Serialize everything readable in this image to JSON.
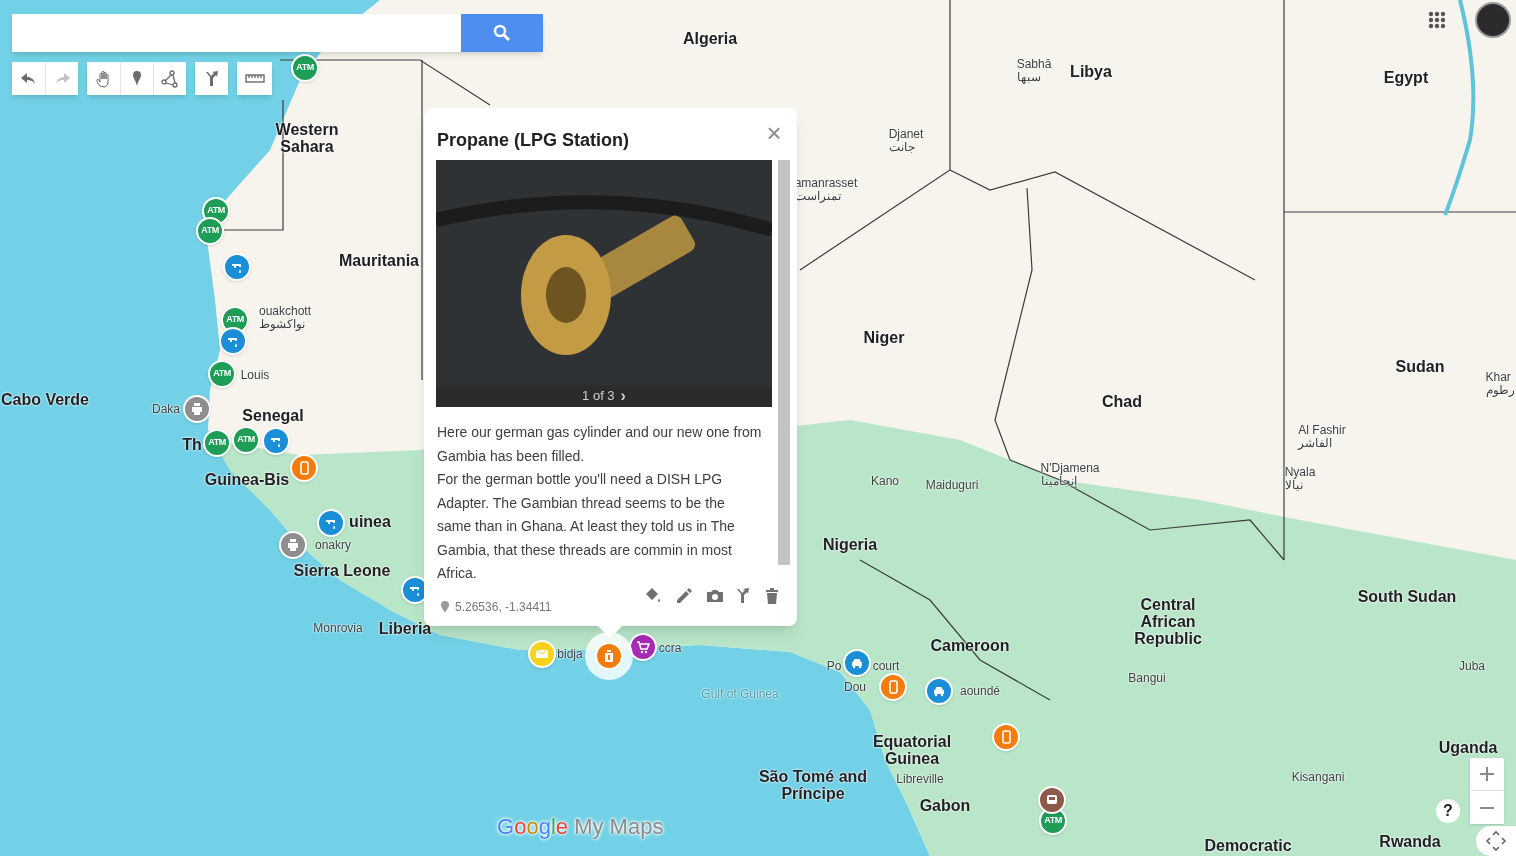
{
  "toolbar": {
    "tools": [
      {
        "kind": "undo",
        "disabled": false
      },
      {
        "kind": "redo",
        "disabled": true
      },
      {
        "kind": "hand",
        "selected": false
      },
      {
        "kind": "marker",
        "selected": false
      },
      {
        "kind": "line",
        "selected": false
      },
      {
        "kind": "route",
        "selected": false
      },
      {
        "kind": "ruler",
        "selected": false
      }
    ]
  },
  "map": {
    "labels": [
      {
        "text": "Algeria",
        "kind": "country"
      },
      {
        "text": "Libya",
        "kind": "country"
      },
      {
        "text": "Egypt",
        "kind": "country"
      },
      {
        "text": "Western Sahara",
        "kind": "country"
      },
      {
        "text": "Mauritania",
        "kind": "country"
      },
      {
        "text": "Niger",
        "kind": "country"
      },
      {
        "text": "Chad",
        "kind": "country"
      },
      {
        "text": "Sudan",
        "kind": "country"
      },
      {
        "text": "Cabo Verde",
        "kind": "country"
      },
      {
        "text": "Senegal",
        "kind": "country"
      },
      {
        "text": "Guinea-Bis",
        "kind": "country"
      },
      {
        "text": "uinea",
        "kind": "country"
      },
      {
        "text": "Sierra Leone",
        "kind": "country"
      },
      {
        "text": "Liberia",
        "kind": "country"
      },
      {
        "text": "Nigeria",
        "kind": "country"
      },
      {
        "text": "Cameroon",
        "kind": "country"
      },
      {
        "text": "Central African Republic",
        "kind": "country"
      },
      {
        "text": "South Sudan",
        "kind": "country"
      },
      {
        "text": "Equatorial Guinea",
        "kind": "country"
      },
      {
        "text": "São Tomé and Príncipe",
        "kind": "country"
      },
      {
        "text": "Gabon",
        "kind": "country"
      },
      {
        "text": "Uganda",
        "kind": "country"
      },
      {
        "text": "Rwanda",
        "kind": "country"
      },
      {
        "text": "Democratic",
        "kind": "country"
      },
      {
        "text": "Th",
        "kind": "country"
      },
      {
        "text": "Gulf of Guinea",
        "kind": "water"
      },
      {
        "text": "Sabhā",
        "native": "سبها",
        "kind": "city"
      },
      {
        "text": "Djanet",
        "native": "جانت",
        "kind": "city"
      },
      {
        "text": "amanrasset",
        "native": "تمنراست",
        "kind": "city"
      },
      {
        "text": "ouakchott",
        "native": "نواكشوط",
        "kind": "city"
      },
      {
        "text": "Louis",
        "kind": "city"
      },
      {
        "text": "Daka",
        "kind": "city"
      },
      {
        "text": "onakry",
        "kind": "city"
      },
      {
        "text": "Monrovia",
        "kind": "city"
      },
      {
        "text": "bidja",
        "kind": "city"
      },
      {
        "text": "ccra",
        "kind": "city"
      },
      {
        "text": "Kano",
        "kind": "city"
      },
      {
        "text": "Maiduguri",
        "kind": "city"
      },
      {
        "text": "N'Djamena",
        "native": "إنجامينا",
        "kind": "city"
      },
      {
        "text": "Al Fashir",
        "native": "الفاشر",
        "kind": "city"
      },
      {
        "text": "Nyala",
        "native": "نيالا",
        "kind": "city"
      },
      {
        "text": "Khar",
        "native": "رطوم",
        "kind": "city"
      },
      {
        "text": "Juba",
        "kind": "city"
      },
      {
        "text": "Bangui",
        "kind": "city"
      },
      {
        "text": "Libreville",
        "kind": "city"
      },
      {
        "text": "Kisangani",
        "kind": "city"
      },
      {
        "text": "aoundé",
        "kind": "city"
      },
      {
        "text": "Dou",
        "kind": "city"
      },
      {
        "text": "Po",
        "kind": "city"
      },
      {
        "text": "court",
        "kind": "city"
      }
    ],
    "markers": [
      {
        "kind": "atm",
        "text": "ATM",
        "selected": false
      },
      {
        "kind": "atm",
        "text": "ATM",
        "selected": false
      },
      {
        "kind": "atm",
        "text": "ATM",
        "selected": false
      },
      {
        "kind": "atm",
        "text": "ATM",
        "selected": false
      },
      {
        "kind": "atm",
        "text": "ATM",
        "selected": false
      },
      {
        "kind": "atm",
        "text": "ATM",
        "selected": false
      },
      {
        "kind": "atm",
        "text": "ATM",
        "selected": false
      },
      {
        "kind": "atm",
        "text": "ATM",
        "selected": false
      },
      {
        "kind": "water",
        "selected": false
      },
      {
        "kind": "water",
        "selected": false
      },
      {
        "kind": "water",
        "selected": false
      },
      {
        "kind": "water",
        "selected": false
      },
      {
        "kind": "water",
        "selected": false
      },
      {
        "kind": "printer",
        "selected": false
      },
      {
        "kind": "printer",
        "selected": false
      },
      {
        "kind": "phone",
        "selected": false
      },
      {
        "kind": "phone",
        "selected": false
      },
      {
        "kind": "phone",
        "selected": false
      },
      {
        "kind": "mail",
        "selected": false
      },
      {
        "kind": "cart",
        "selected": false
      },
      {
        "kind": "car",
        "selected": false
      },
      {
        "kind": "car",
        "selected": false
      },
      {
        "kind": "bus",
        "selected": false
      },
      {
        "kind": "propane",
        "selected": true
      }
    ]
  },
  "popup": {
    "title": "Propane (LPG Station)",
    "close": "×",
    "photo_pager": {
      "text": "1 of 3",
      "next": "›"
    },
    "description": [
      "Here our german gas cylinder and our new one from Gambia has been filled.",
      "For the german bottle you'll need a DISH LPG Adapter. The Gambian thread seems to be the same than in Ghana. At least they told us in The Gambia, that these threads are commin in most Africa."
    ],
    "coordinates": "5.26536, -1.34411",
    "actions": [
      {
        "kind": "style"
      },
      {
        "kind": "edit"
      },
      {
        "kind": "photo"
      },
      {
        "kind": "directions"
      },
      {
        "kind": "delete"
      }
    ]
  },
  "logo": "Google My Maps",
  "help": "?"
}
